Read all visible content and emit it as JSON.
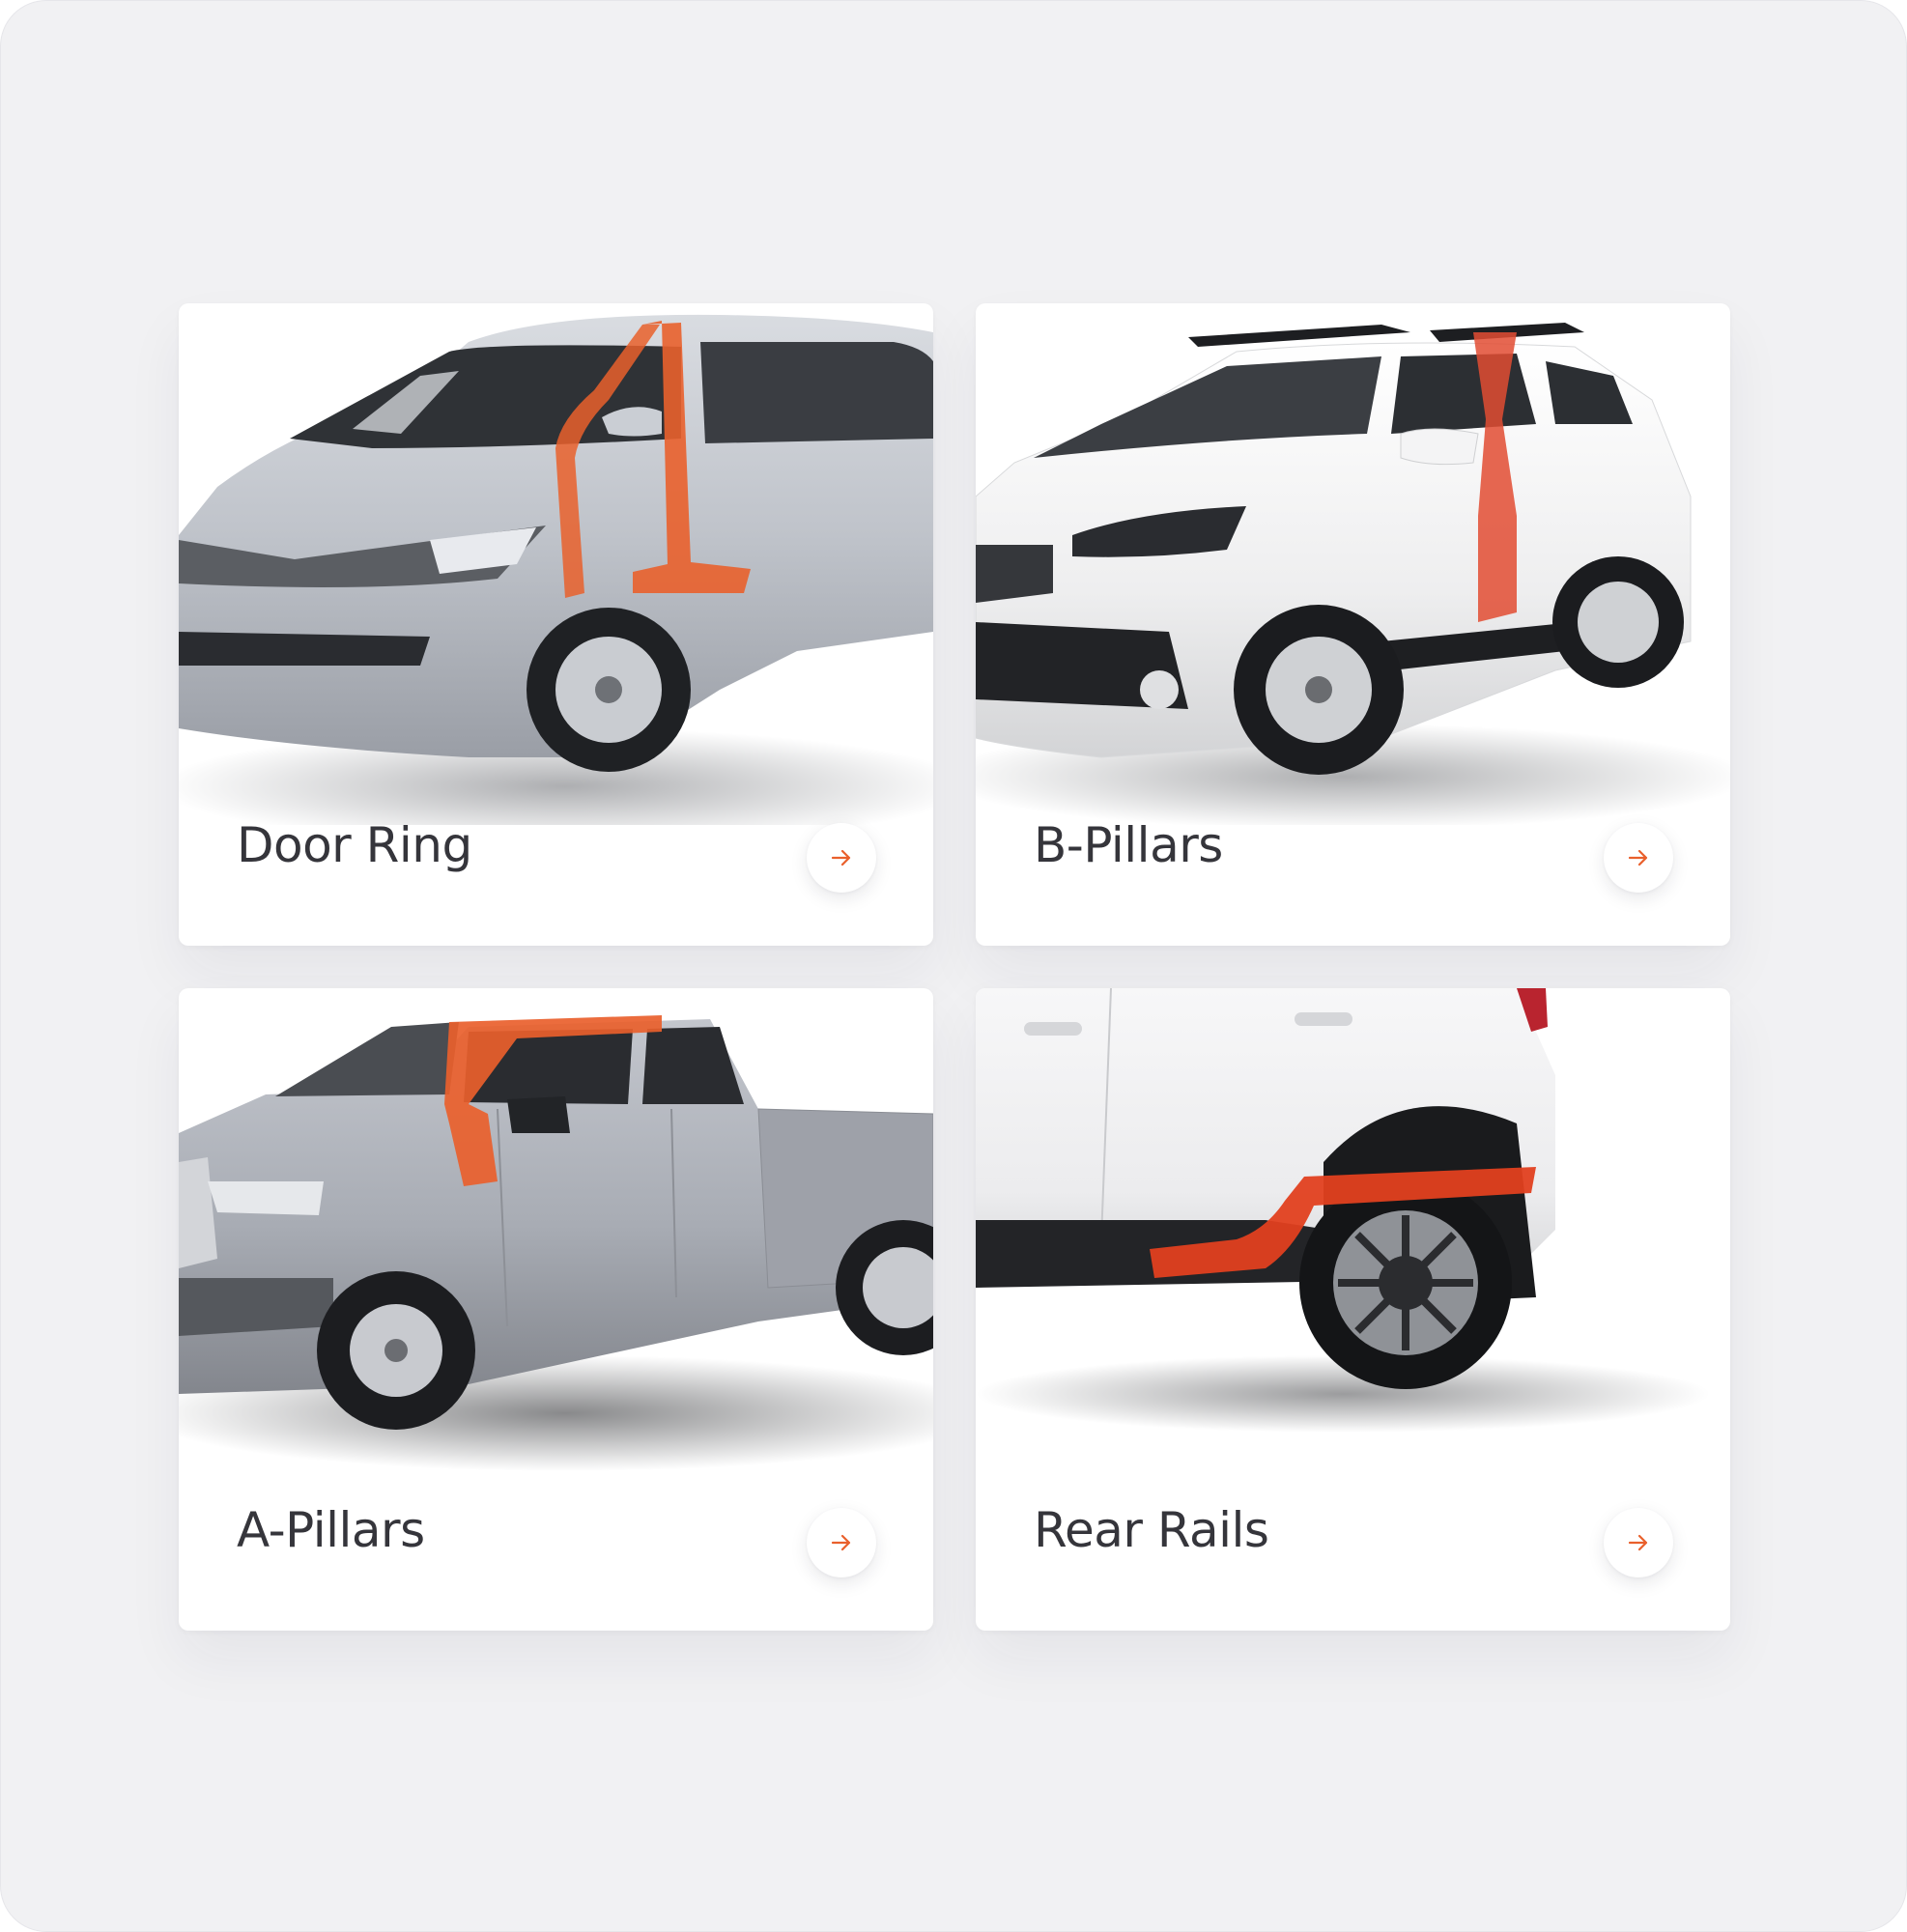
{
  "theme": {
    "accent": "#e9602c",
    "text": "#35353b",
    "page_background": "#f1f1f3",
    "card_background": "#ffffff"
  },
  "cards": [
    {
      "title": "Door Ring",
      "image": "silver-minivan-with-orange-door-ring",
      "vehicle_color": "#b9bdc4",
      "highlight_color": "#e9602c",
      "action_icon": "arrow-right-icon"
    },
    {
      "title": "B-Pillars",
      "image": "white-suv-with-orange-b-pillar",
      "vehicle_color": "#f4f4f4",
      "highlight_color": "#e24c32",
      "action_icon": "arrow-right-icon"
    },
    {
      "title": "A-Pillars",
      "image": "silver-pickup-truck-with-orange-a-pillar",
      "vehicle_color": "#a3a6ae",
      "highlight_color": "#e9602c",
      "action_icon": "arrow-right-icon"
    },
    {
      "title": "Rear Rails",
      "image": "white-suv-rear-with-orange-rear-rail",
      "vehicle_color": "#f6f6f6",
      "highlight_color": "#e2401f",
      "action_icon": "arrow-right-icon"
    }
  ]
}
